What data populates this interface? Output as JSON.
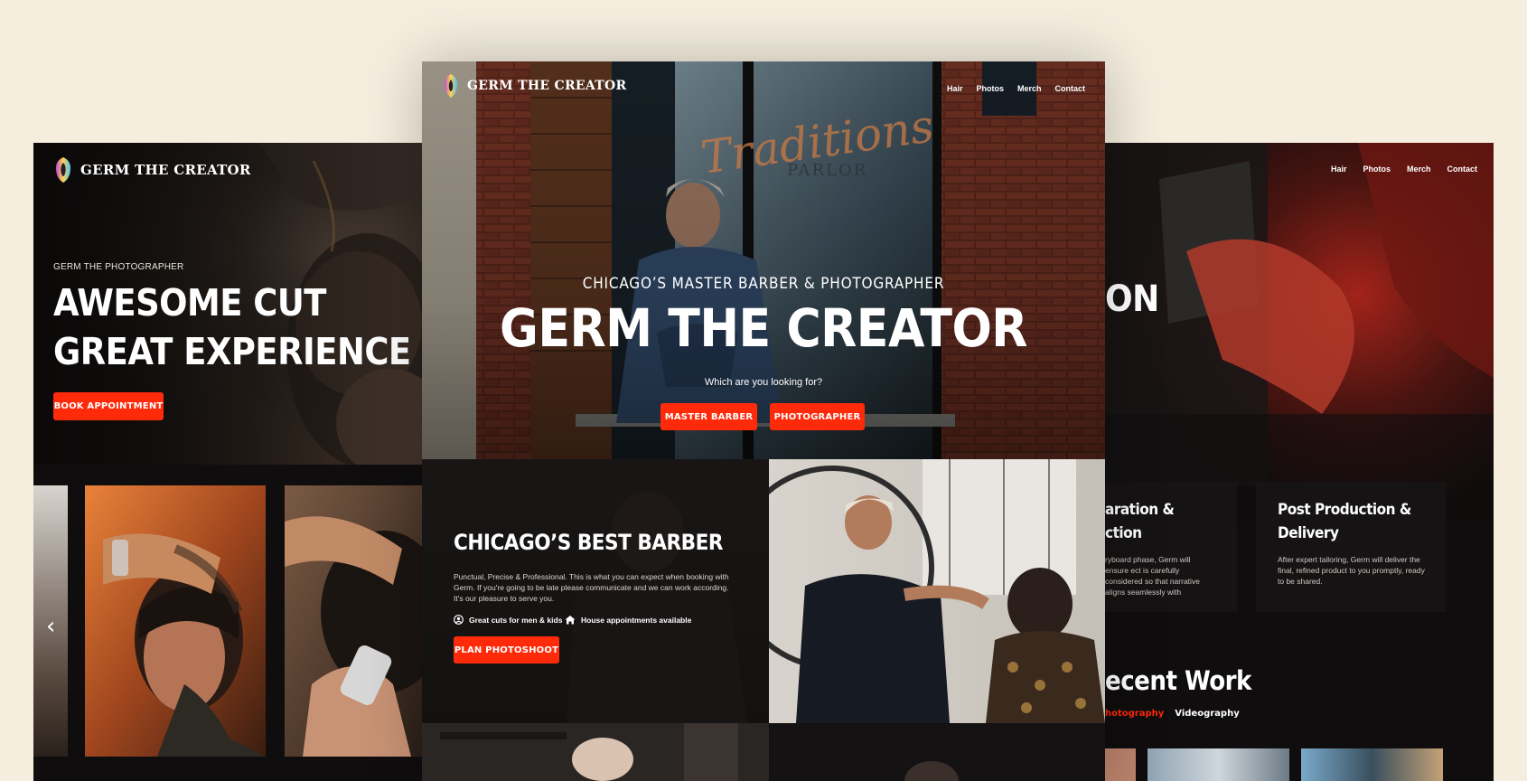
{
  "left": {
    "logo_text": "GERM THE CREATOR",
    "eyebrow": "GERM THE PHOTOGRAPHER",
    "headline_line1": "AWESOME CUT",
    "headline_line2": "GREAT EXPERIENCE",
    "book_button": "BOOK APPOINTMENT",
    "carousel_prev": "‹"
  },
  "center": {
    "logo_text": "GERM THE CREATOR",
    "nav": [
      "Hair",
      "Photos",
      "Merch",
      "Contact"
    ],
    "subtitle": "CHICAGO’S MASTER BARBER & PHOTOGRAPHER",
    "title": "GERM THE CREATOR",
    "question": "Which are you looking for?",
    "button_barber": "MASTER BARBER",
    "button_photographer": "PHOTOGRAPHER",
    "section": {
      "heading": "CHICAGO’S BEST BARBER",
      "body": "Punctual, Precise & Professional. This is what you can expect when booking with Germ. If you're going to be late please communicate and we can work according. It's our pleasure to serve you.",
      "feature1": "Great cuts for men & kids",
      "feature2": "House appointments available",
      "cta": "PLAN PHOTOSHOOT"
    },
    "sign_text": "Traditions",
    "sign_sub": "PARLOR"
  },
  "right": {
    "nav": [
      "Hair",
      "Photos",
      "Merch",
      "Contact"
    ],
    "partial_headline": "ON",
    "card1": {
      "title_line1": "aration &",
      "title_line2": "ction",
      "body": "ryboard phase, Germ will ensure ect is carefully considered so that narrative aligns seamlessly with"
    },
    "card2": {
      "title_line1": "Post Production &",
      "title_line2": "Delivery",
      "body": "After expert tailoring, Germ will deliver the final, refined product to you promptly, ready to be shared."
    },
    "recent_heading": "ecent Work",
    "tabs": [
      "hotography",
      "Videography"
    ]
  },
  "colors": {
    "accent": "#ff2a0a",
    "page_bg": "#f5eedf",
    "panel_bg": "#0f0d0d"
  }
}
